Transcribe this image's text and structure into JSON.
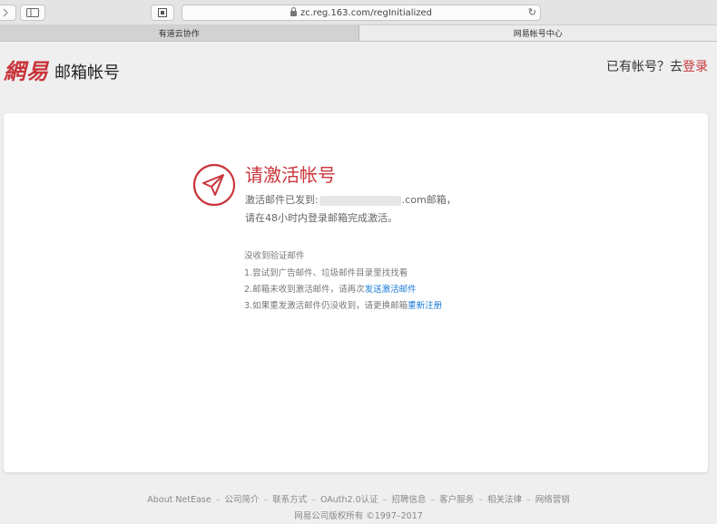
{
  "browser": {
    "url": "zc.reg.163.com/regInitialized",
    "tabs": [
      {
        "label": "有道云协作",
        "active": false
      },
      {
        "label": "网易帐号中心",
        "active": true
      }
    ]
  },
  "header": {
    "logo_mark": "網易",
    "logo_title": "邮箱帐号",
    "login_prompt": "已有帐号？去",
    "login_link": "登录"
  },
  "main": {
    "title": "请激活帐号",
    "line1_prefix": "激活邮件已发到:",
    "line1_suffix": ".com邮箱，",
    "line2": "请在48小时内登录邮箱完成激活。",
    "help_title": "没收到验证邮件",
    "help1": "1.尝试到广告邮件、垃圾邮件目录里找找看",
    "help2_text": "2.邮箱未收到激活邮件，请再次",
    "help2_link": "发送激活邮件",
    "help3_text": "3.如果重发激活邮件仍没收到，请更换邮箱",
    "help3_link": "重新注册"
  },
  "footer": {
    "links": [
      "About NetEase",
      "公司简介",
      "联系方式",
      "OAuth2.0认证",
      "招聘信息",
      "客户服务",
      "相关法律",
      "网络营销"
    ],
    "separator": "–",
    "copyright": "网易公司版权所有 ©1997–2017"
  },
  "colors": {
    "brand_red": "#c9353b",
    "link_blue": "#1a7ad6"
  },
  "icons": [
    "chevron-right-icon",
    "sidebar-icon",
    "reader-icon",
    "lock-icon",
    "reload-icon",
    "paper-plane-icon"
  ]
}
